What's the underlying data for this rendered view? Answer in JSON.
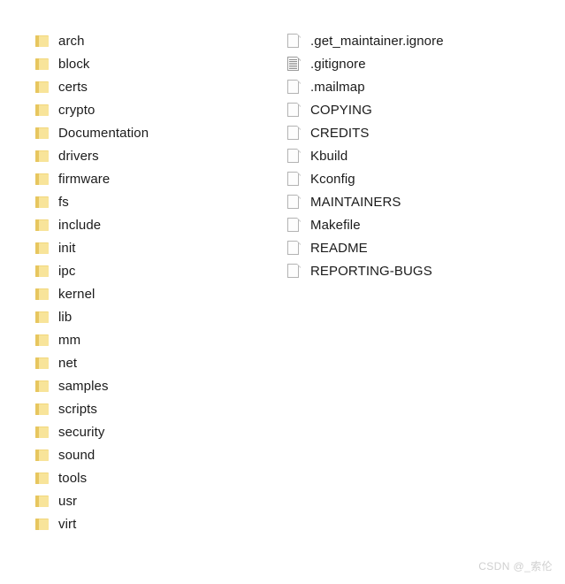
{
  "view": {
    "background_color": "#ffffff",
    "text_color": "#1b1b1b",
    "folder_icon_color": "#f2d77c",
    "file_icon_color": "#b3b3b3"
  },
  "columns": [
    {
      "name": "folders-column",
      "entries": [
        {
          "label": "arch",
          "icon": "folder-icon",
          "type": "folder"
        },
        {
          "label": "block",
          "icon": "folder-icon",
          "type": "folder"
        },
        {
          "label": "certs",
          "icon": "folder-icon",
          "type": "folder"
        },
        {
          "label": "crypto",
          "icon": "folder-icon",
          "type": "folder"
        },
        {
          "label": "Documentation",
          "icon": "folder-icon",
          "type": "folder"
        },
        {
          "label": "drivers",
          "icon": "folder-icon",
          "type": "folder"
        },
        {
          "label": "firmware",
          "icon": "folder-icon",
          "type": "folder"
        },
        {
          "label": "fs",
          "icon": "folder-icon",
          "type": "folder"
        },
        {
          "label": "include",
          "icon": "folder-icon",
          "type": "folder"
        },
        {
          "label": "init",
          "icon": "folder-icon",
          "type": "folder"
        },
        {
          "label": "ipc",
          "icon": "folder-icon",
          "type": "folder"
        },
        {
          "label": "kernel",
          "icon": "folder-icon",
          "type": "folder"
        },
        {
          "label": "lib",
          "icon": "folder-icon",
          "type": "folder"
        },
        {
          "label": "mm",
          "icon": "folder-icon",
          "type": "folder"
        },
        {
          "label": "net",
          "icon": "folder-icon",
          "type": "folder"
        },
        {
          "label": "samples",
          "icon": "folder-icon",
          "type": "folder"
        },
        {
          "label": "scripts",
          "icon": "folder-icon",
          "type": "folder"
        },
        {
          "label": "security",
          "icon": "folder-icon",
          "type": "folder"
        },
        {
          "label": "sound",
          "icon": "folder-icon",
          "type": "folder"
        },
        {
          "label": "tools",
          "icon": "folder-icon",
          "type": "folder"
        },
        {
          "label": "usr",
          "icon": "folder-icon",
          "type": "folder"
        },
        {
          "label": "virt",
          "icon": "folder-icon",
          "type": "folder"
        }
      ]
    },
    {
      "name": "files-column",
      "entries": [
        {
          "label": ".get_maintainer.ignore",
          "icon": "page-icon",
          "type": "file"
        },
        {
          "label": ".gitignore",
          "icon": "text-doc-icon",
          "type": "file"
        },
        {
          "label": ".mailmap",
          "icon": "page-icon",
          "type": "file"
        },
        {
          "label": "COPYING",
          "icon": "page-icon",
          "type": "file"
        },
        {
          "label": "CREDITS",
          "icon": "page-icon",
          "type": "file"
        },
        {
          "label": "Kbuild",
          "icon": "page-icon",
          "type": "file"
        },
        {
          "label": "Kconfig",
          "icon": "page-icon",
          "type": "file"
        },
        {
          "label": "MAINTAINERS",
          "icon": "page-icon",
          "type": "file"
        },
        {
          "label": "Makefile",
          "icon": "page-icon",
          "type": "file"
        },
        {
          "label": "README",
          "icon": "page-icon",
          "type": "file"
        },
        {
          "label": "REPORTING-BUGS",
          "icon": "page-icon",
          "type": "file"
        }
      ]
    }
  ],
  "watermark": {
    "text": "CSDN @_索伦"
  }
}
